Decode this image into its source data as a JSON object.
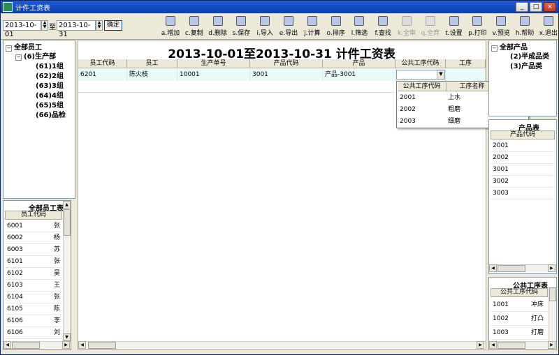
{
  "window": {
    "title": "计件工资表",
    "min": "_",
    "max": "□",
    "close": "×"
  },
  "toolbar": {
    "date_from": "2013-10-01",
    "to_label": "至",
    "date_to": "2013-10-31",
    "confirm": "确定",
    "buttons": [
      {
        "label": "a.增加",
        "enabled": true
      },
      {
        "label": "c.复制",
        "enabled": true
      },
      {
        "label": "d.删除",
        "enabled": true
      },
      {
        "label": "s.保存",
        "enabled": true
      },
      {
        "label": "i.导入",
        "enabled": true
      },
      {
        "label": "e.导出",
        "enabled": true
      },
      {
        "label": "j.计算",
        "enabled": true
      },
      {
        "label": "o.排序",
        "enabled": true
      },
      {
        "label": "l.筛选",
        "enabled": true
      },
      {
        "label": "f.查找",
        "enabled": true
      },
      {
        "label": "k.全审",
        "enabled": false
      },
      {
        "label": "q.全弃",
        "enabled": false
      },
      {
        "label": "t.设置",
        "enabled": true
      },
      {
        "label": "p.打印",
        "enabled": true
      },
      {
        "label": "v.预览",
        "enabled": true
      },
      {
        "label": "h.帮助",
        "enabled": true
      },
      {
        "label": "x.退出",
        "enabled": true
      }
    ]
  },
  "left_tree": {
    "root": "全部员工",
    "dept": "(6)生产部",
    "groups": [
      "(61)1组",
      "(62)2组",
      "(63)3组",
      "(64)4组",
      "(65)5组",
      "(66)品检"
    ]
  },
  "employee_table": {
    "title": "全部员工表",
    "column": "员工代码",
    "rows": [
      {
        "code": "6001",
        "name": "张"
      },
      {
        "code": "6002",
        "name": "杨"
      },
      {
        "code": "6003",
        "name": "苏"
      },
      {
        "code": "6101",
        "name": "张"
      },
      {
        "code": "6102",
        "name": "吴"
      },
      {
        "code": "6103",
        "name": "王"
      },
      {
        "code": "6104",
        "name": "张"
      },
      {
        "code": "6105",
        "name": "陈"
      },
      {
        "code": "6106",
        "name": "李"
      },
      {
        "code": "6106",
        "name": "刘"
      }
    ]
  },
  "main": {
    "title": "2013-10-01至2013-10-31 计件工资表",
    "columns": [
      "员工代码",
      "员工",
      "生产单号",
      "产品代码",
      "产品",
      "公共工序代码",
      "工序"
    ],
    "row": [
      "6201",
      "陈火枝",
      "10001",
      "3001",
      "产品-3001",
      ""
    ]
  },
  "dropdown": {
    "columns": [
      "公共工序代码",
      "工序名称"
    ],
    "rows": [
      {
        "code": "2001",
        "name": "上水"
      },
      {
        "code": "2002",
        "name": "粗磨"
      },
      {
        "code": "2003",
        "name": "细磨"
      }
    ]
  },
  "right_tree": {
    "root": "全部产品",
    "items": [
      "(2)半成品类",
      "(3)产品类"
    ]
  },
  "product_table": {
    "title": "产品表",
    "column": "产品代码",
    "rows": [
      "2001",
      "2002",
      "3001",
      "3002",
      "3003"
    ]
  },
  "process_table": {
    "title": "公共工序表",
    "column": "公共工序代码",
    "rows": [
      {
        "code": "1001",
        "name": "冲床"
      },
      {
        "code": "1002",
        "name": "打凸"
      },
      {
        "code": "1003",
        "name": "打磨"
      }
    ]
  }
}
